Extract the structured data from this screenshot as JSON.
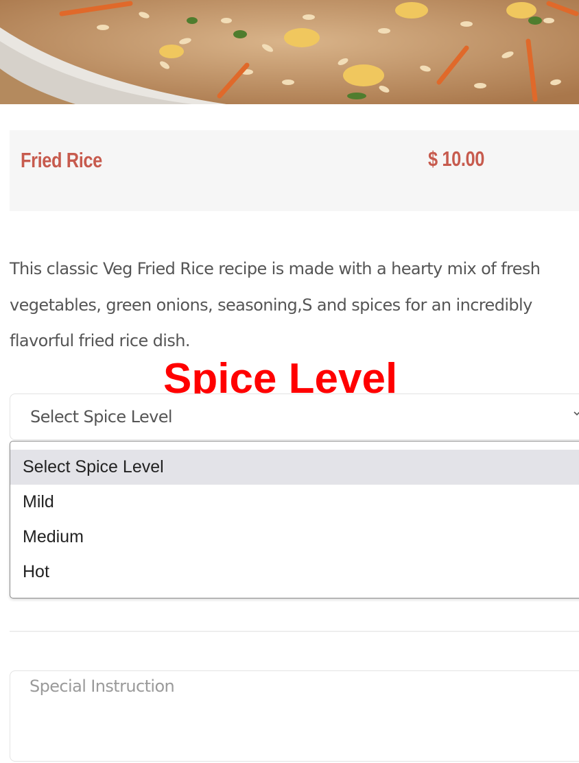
{
  "hero": {
    "icon": "fried-rice-photo"
  },
  "item": {
    "name": "Fried Rice",
    "price": "$ 10.00",
    "description": "This classic Veg Fried Rice recipe is made with a hearty mix of fresh vegetables, green onions, seasoning,S and spices for an incredibly flavorful fried rice dish."
  },
  "annotation": {
    "label": "Spice Level"
  },
  "spice_select": {
    "selected": "Select Spice Level",
    "options": [
      "Select Spice Level",
      "Mild",
      "Medium",
      "Hot"
    ]
  },
  "special_instruction": {
    "placeholder": "Special Instruction"
  },
  "colors": {
    "accent": "#c75b4e",
    "annotation": "#ff0000"
  }
}
